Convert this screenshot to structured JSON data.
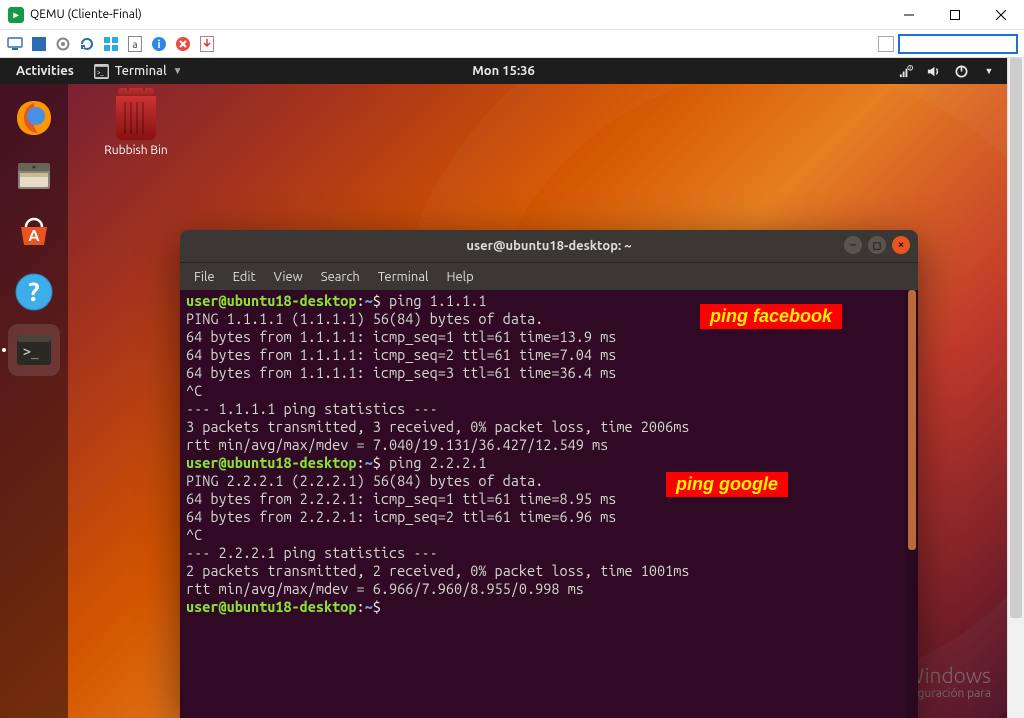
{
  "host_window": {
    "title": "QEMU (Cliente-Final)"
  },
  "host_toolbar": {
    "icons": [
      "monitor",
      "fullscreen",
      "settings",
      "refresh",
      "windows",
      "doc-a",
      "info",
      "stop",
      "export"
    ]
  },
  "gnome_panel": {
    "activities": "Activities",
    "app_menu": "Terminal",
    "clock": "Mon 15:36"
  },
  "desktop": {
    "rubbish_bin_label": "Rubbish Bin"
  },
  "terminal": {
    "title": "user@ubuntu18-desktop: ~",
    "menu": [
      "File",
      "Edit",
      "View",
      "Search",
      "Terminal",
      "Help"
    ],
    "prompt_user": "user@ubuntu18-desktop",
    "prompt_sep": ":",
    "prompt_path": "~",
    "prompt_suffix": "$",
    "cmd1": "ping 1.1.1.1",
    "out1": [
      "PING 1.1.1.1 (1.1.1.1) 56(84) bytes of data.",
      "64 bytes from 1.1.1.1: icmp_seq=1 ttl=61 time=13.9 ms",
      "64 bytes from 1.1.1.1: icmp_seq=2 ttl=61 time=7.04 ms",
      "64 bytes from 1.1.1.1: icmp_seq=3 ttl=61 time=36.4 ms",
      "^C",
      "--- 1.1.1.1 ping statistics ---",
      "3 packets transmitted, 3 received, 0% packet loss, time 2006ms",
      "rtt min/avg/max/mdev = 7.040/19.131/36.427/12.549 ms"
    ],
    "cmd2": "ping 2.2.2.1",
    "out2": [
      "PING 2.2.2.1 (2.2.2.1) 56(84) bytes of data.",
      "64 bytes from 2.2.2.1: icmp_seq=1 ttl=61 time=8.95 ms",
      "64 bytes from 2.2.2.1: icmp_seq=2 ttl=61 time=6.96 ms",
      "^C",
      "--- 2.2.2.1 ping statistics ---",
      "2 packets transmitted, 2 received, 0% packet loss, time 1001ms",
      "rtt min/avg/max/mdev = 6.966/7.960/8.955/0.998 ms"
    ]
  },
  "annotations": {
    "a1": "ping facebook",
    "a2": "ping google"
  },
  "watermark": {
    "line1": "Activar Windows",
    "line2": "Ve a Configuración para"
  }
}
